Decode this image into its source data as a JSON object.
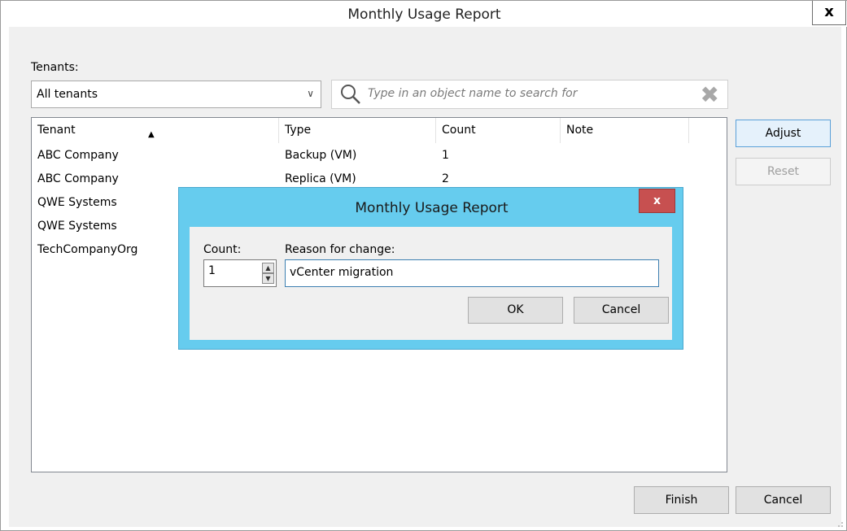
{
  "window": {
    "title": "Monthly Usage Report",
    "close_glyph": "x"
  },
  "tenants_label": "Tenants:",
  "tenant_select": {
    "value": "All tenants"
  },
  "search": {
    "placeholder": "Type in an object name to search for"
  },
  "grid": {
    "columns": [
      "Tenant",
      "Type",
      "Count",
      "Note"
    ],
    "rows": [
      {
        "tenant": "ABC Company",
        "type": "Backup (VM)",
        "count": "1",
        "note": ""
      },
      {
        "tenant": "ABC Company",
        "type": "Replica (VM)",
        "count": "2",
        "note": ""
      },
      {
        "tenant": "QWE Systems",
        "type": "",
        "count": "",
        "note": ""
      },
      {
        "tenant": "QWE Systems",
        "type": "",
        "count": "",
        "note": ""
      },
      {
        "tenant": "TechCompanyOrg",
        "type": "",
        "count": "",
        "note": ""
      }
    ]
  },
  "side_buttons": {
    "adjust": "Adjust",
    "reset": "Reset"
  },
  "footer": {
    "finish": "Finish",
    "cancel": "Cancel"
  },
  "modal": {
    "title": "Monthly Usage Report",
    "close_glyph": "x",
    "count_label": "Count:",
    "count_value": "1",
    "reason_label": "Reason for change:",
    "reason_value": "vCenter migration",
    "ok": "OK",
    "cancel": "Cancel"
  },
  "colors": {
    "modal_frame": "#66ccee",
    "modal_close": "#c75050",
    "client_bg": "#f0f0f0",
    "button_bg": "#e1e1e1"
  },
  "icons": [
    "close-icon",
    "chevron-down-icon",
    "search-icon",
    "clear-search-icon",
    "sort-ascending-icon",
    "spin-up-icon",
    "spin-down-icon",
    "resize-grip-icon"
  ]
}
